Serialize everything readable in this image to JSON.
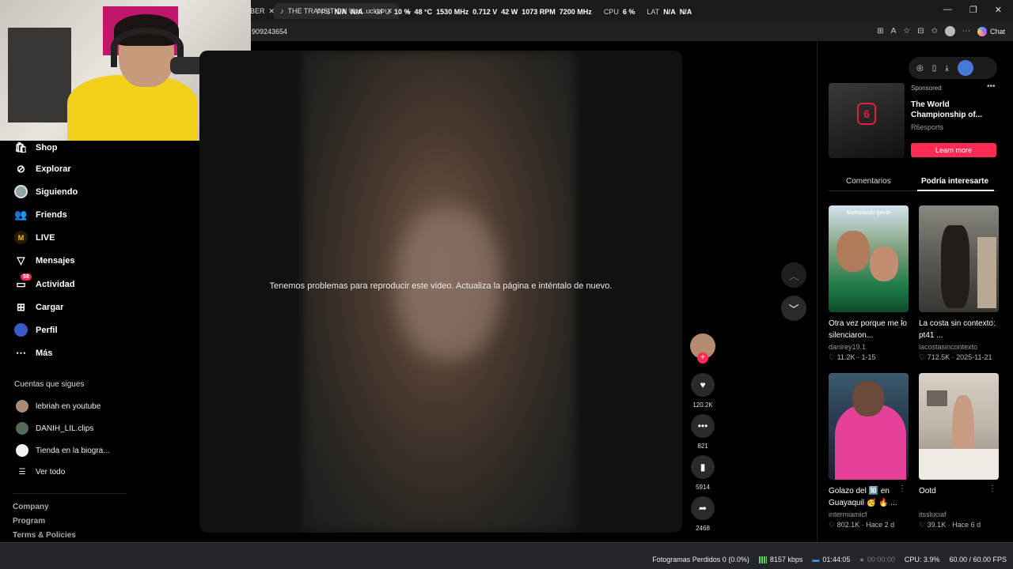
{
  "browser": {
    "tab_partial": "BER",
    "tab_active_title": "THE TRANSITION Und..ucket LM...",
    "url": "909243654",
    "chat_label": "Chat",
    "osd": {
      "fps_label": "FPS",
      "fps_v1": "N/A",
      "fps_v2": "N/A",
      "gpu_label": "GPU",
      "gpu_load": "10 %",
      "gpu_temp": "48 °C",
      "gpu_clock": "1530 MHz",
      "gpu_volt": "0.712 V",
      "gpu_power": "42 W",
      "gpu_fan": "1073 RPM",
      "gpu_mem": "7200 MHz",
      "cpu_label": "CPU",
      "cpu_load": "6 %",
      "lat_label": "LAT",
      "lat_v1": "N/A",
      "lat_v2": "N/A"
    }
  },
  "sidebar": {
    "items": [
      {
        "label": "Shop",
        "icon": "shop-icon"
      },
      {
        "label": "Explorar",
        "icon": "compass-icon"
      },
      {
        "label": "Siguiendo",
        "icon": "following-icon"
      },
      {
        "label": "Friends",
        "icon": "friends-icon"
      },
      {
        "label": "LIVE",
        "icon": "live-icon"
      },
      {
        "label": "Mensajes",
        "icon": "send-icon"
      },
      {
        "label": "Actividad",
        "icon": "bell-icon",
        "badge": "58"
      },
      {
        "label": "Cargar",
        "icon": "upload-icon"
      },
      {
        "label": "Perfil",
        "icon": "profile-icon"
      },
      {
        "label": "Más",
        "icon": "more-icon"
      }
    ],
    "following_title": "Cuentas que sigues",
    "following": [
      "lebriah en youtube",
      "DANIH_LIL.clips",
      "Tienda en la biogra..."
    ],
    "see_all": "Ver todo",
    "footer": [
      "Company",
      "Program",
      "Terms & Policies"
    ]
  },
  "video": {
    "message": "Tenemos problemas para reproducir este video. Actualiza la página e inténtalo de nuevo."
  },
  "actions": {
    "likes": "120.2K",
    "comments": "821",
    "saves": "5914",
    "shares": "2468"
  },
  "ad": {
    "sponsored": "Sponsored",
    "title": "The World Championship of...",
    "brand": "R6esports",
    "cta": "Learn more",
    "logo_text": "6"
  },
  "tabs": {
    "comments": "Comentarios",
    "related": "Podría interesarte"
  },
  "cards": [
    {
      "title": "Otra vez porque me lo silenciaron...",
      "author": "danirey19.1",
      "likes": "11.2K",
      "date": "1-15",
      "overlay": "Molestando gente"
    },
    {
      "title": "La costa sin contexto: pt41 ...",
      "author": "lacostasincontexto",
      "likes": "712.5K",
      "date": "2025-11-21"
    },
    {
      "title": "Golazo del 🔟 en Guayaquil 🥳 🔥 ...",
      "author": "intermiamicf",
      "likes": "802.1K",
      "date": "Hace 2 d"
    },
    {
      "title": "Ootd",
      "author": "itssluciaf",
      "likes": "39.1K",
      "date": "Hace 6 d"
    }
  ],
  "status": {
    "dropped": "Fotogramas Perdidos 0 (0.0%)",
    "bitrate": "8157 kbps",
    "rec_time": "01:44:05",
    "stream_time": "00:00:00",
    "cpu": "CPU: 3.9%",
    "fps": "60.00 / 60.00 FPS"
  }
}
